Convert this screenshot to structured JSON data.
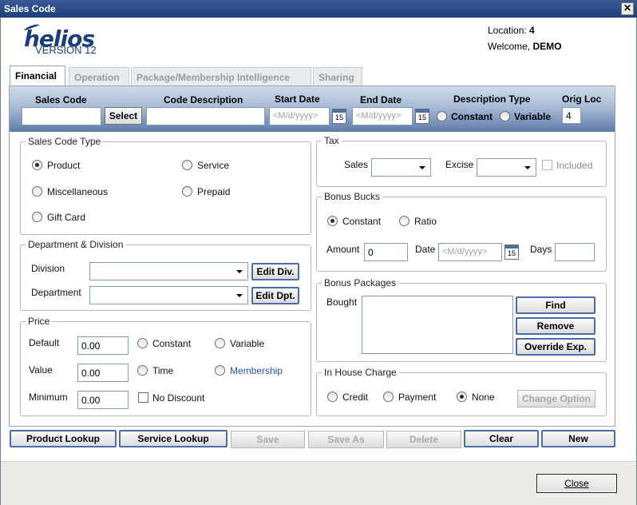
{
  "window": {
    "title": "Sales Code"
  },
  "header": {
    "logo_name": "helios",
    "logo_version": "VERSION 12",
    "location_label": "Location:",
    "location_value": "4",
    "welcome_label": "Welcome,",
    "welcome_value": "DEMO"
  },
  "tabs": [
    {
      "label": "Financial"
    },
    {
      "label": "Operation"
    },
    {
      "label": "Package/Membership Intelligence"
    },
    {
      "label": "Sharing"
    }
  ],
  "band": {
    "sales_code_label": "Sales Code",
    "sales_code_value": "",
    "select_button": "Select",
    "code_description_label": "Code Description",
    "code_description_value": "",
    "start_date_label": "Start Date",
    "start_date_placeholder": "<M/d/yyyy>",
    "end_date_label": "End Date",
    "end_date_placeholder": "<M/d/yyyy>",
    "calendar_day": "15",
    "description_type_label": "Description Type",
    "constant_label": "Constant",
    "variable_label": "Variable",
    "orig_loc_label": "Orig Loc",
    "orig_loc_value": "4"
  },
  "sales_code_type": {
    "title": "Sales Code Type",
    "options": [
      "Product",
      "Service",
      "Miscellaneous",
      "Prepaid",
      "Gift Card"
    ],
    "selected": "Product"
  },
  "department_division": {
    "title": "Department & Division",
    "division_label": "Division",
    "department_label": "Department",
    "edit_div_button": "Edit Div.",
    "edit_dpt_button": "Edit Dpt."
  },
  "price": {
    "title": "Price",
    "default_label": "Default",
    "default_value": "0.00",
    "value_label": "Value",
    "value_value": "0.00",
    "minimum_label": "Minimum",
    "minimum_value": "0.00",
    "constant_label": "Constant",
    "variable_label": "Variable",
    "time_label": "Time",
    "membership_label": "Membership",
    "no_discount_label": "No Discount"
  },
  "tax": {
    "title": "Tax",
    "sales_label": "Sales",
    "excise_label": "Excise",
    "included_label": "Included"
  },
  "bonus_bucks": {
    "title": "Bonus Bucks",
    "constant_label": "Constant",
    "ratio_label": "Ratio",
    "selected": "Constant",
    "amount_label": "Amount",
    "amount_value": "0",
    "date_label": "Date",
    "date_placeholder": "<M/d/yyyy>",
    "days_label": "Days",
    "days_value": ""
  },
  "bonus_packages": {
    "title": "Bonus Packages",
    "bought_label": "Bought",
    "find_button": "Find",
    "remove_button": "Remove",
    "override_button": "Override Exp."
  },
  "in_house_charge": {
    "title": "In House Charge",
    "credit_label": "Credit",
    "payment_label": "Payment",
    "none_label": "None",
    "selected": "None",
    "change_option_button": "Change Option"
  },
  "actions": {
    "product_lookup": "Product Lookup",
    "service_lookup": "Service Lookup",
    "save": "Save",
    "save_as": "Save As",
    "delete": "Delete",
    "clear": "Clear",
    "new": "New"
  },
  "footer": {
    "close_button": "Close"
  }
}
